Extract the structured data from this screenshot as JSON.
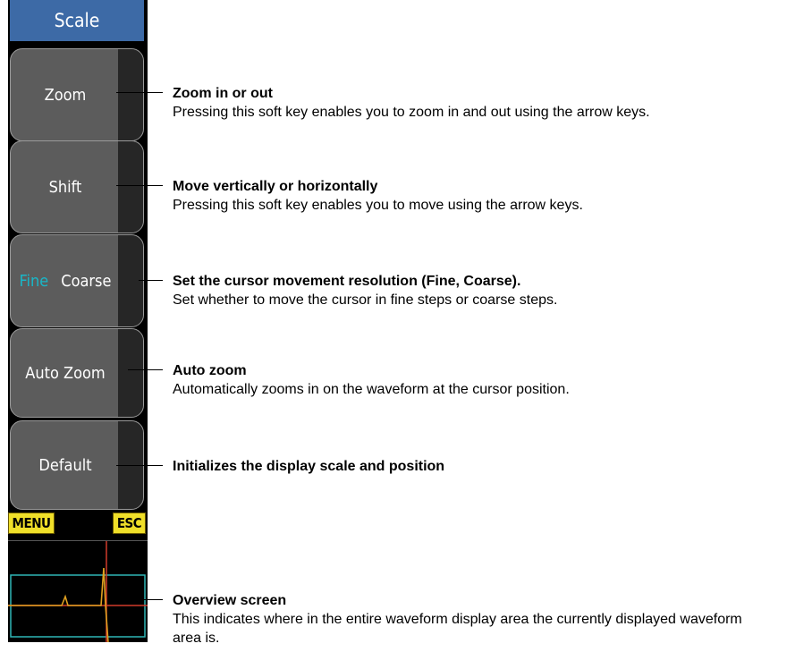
{
  "panel": {
    "title": "Scale",
    "keys": {
      "zoom": "Zoom",
      "shift": "Shift",
      "fine": "Fine",
      "coarse": "Coarse",
      "auto_zoom": "Auto Zoom",
      "default": "Default"
    },
    "menu_label": "MENU",
    "esc_label": "ESC"
  },
  "annotations": {
    "zoom": {
      "title": "Zoom in or out",
      "desc": "Pressing this soft key enables you to zoom in and out using the arrow keys."
    },
    "shift": {
      "title": "Move vertically or horizontally",
      "desc": "Pressing this soft key enables you to move using the arrow keys."
    },
    "resolution": {
      "title": "Set the cursor movement resolution (Fine, Coarse).",
      "desc": "Set whether to move the cursor in fine steps or coarse steps."
    },
    "auto_zoom": {
      "title": "Auto zoom",
      "desc": "Automatically zooms in on the waveform at the cursor position."
    },
    "default": {
      "title": "Initializes the display scale and position"
    },
    "overview": {
      "title": "Overview screen",
      "desc": "This indicates where in the entire waveform display area the currently displayed waveform area is."
    }
  },
  "colors": {
    "title_bar": "#3d6aa6",
    "key_face": "#5c5c5c",
    "fine_selected": "#19b7c8",
    "mini_keys": "#f0df29",
    "overview_frame": "#2fb6b6",
    "cursor_line": "#d03a2a",
    "waveform": "#e0a020"
  }
}
